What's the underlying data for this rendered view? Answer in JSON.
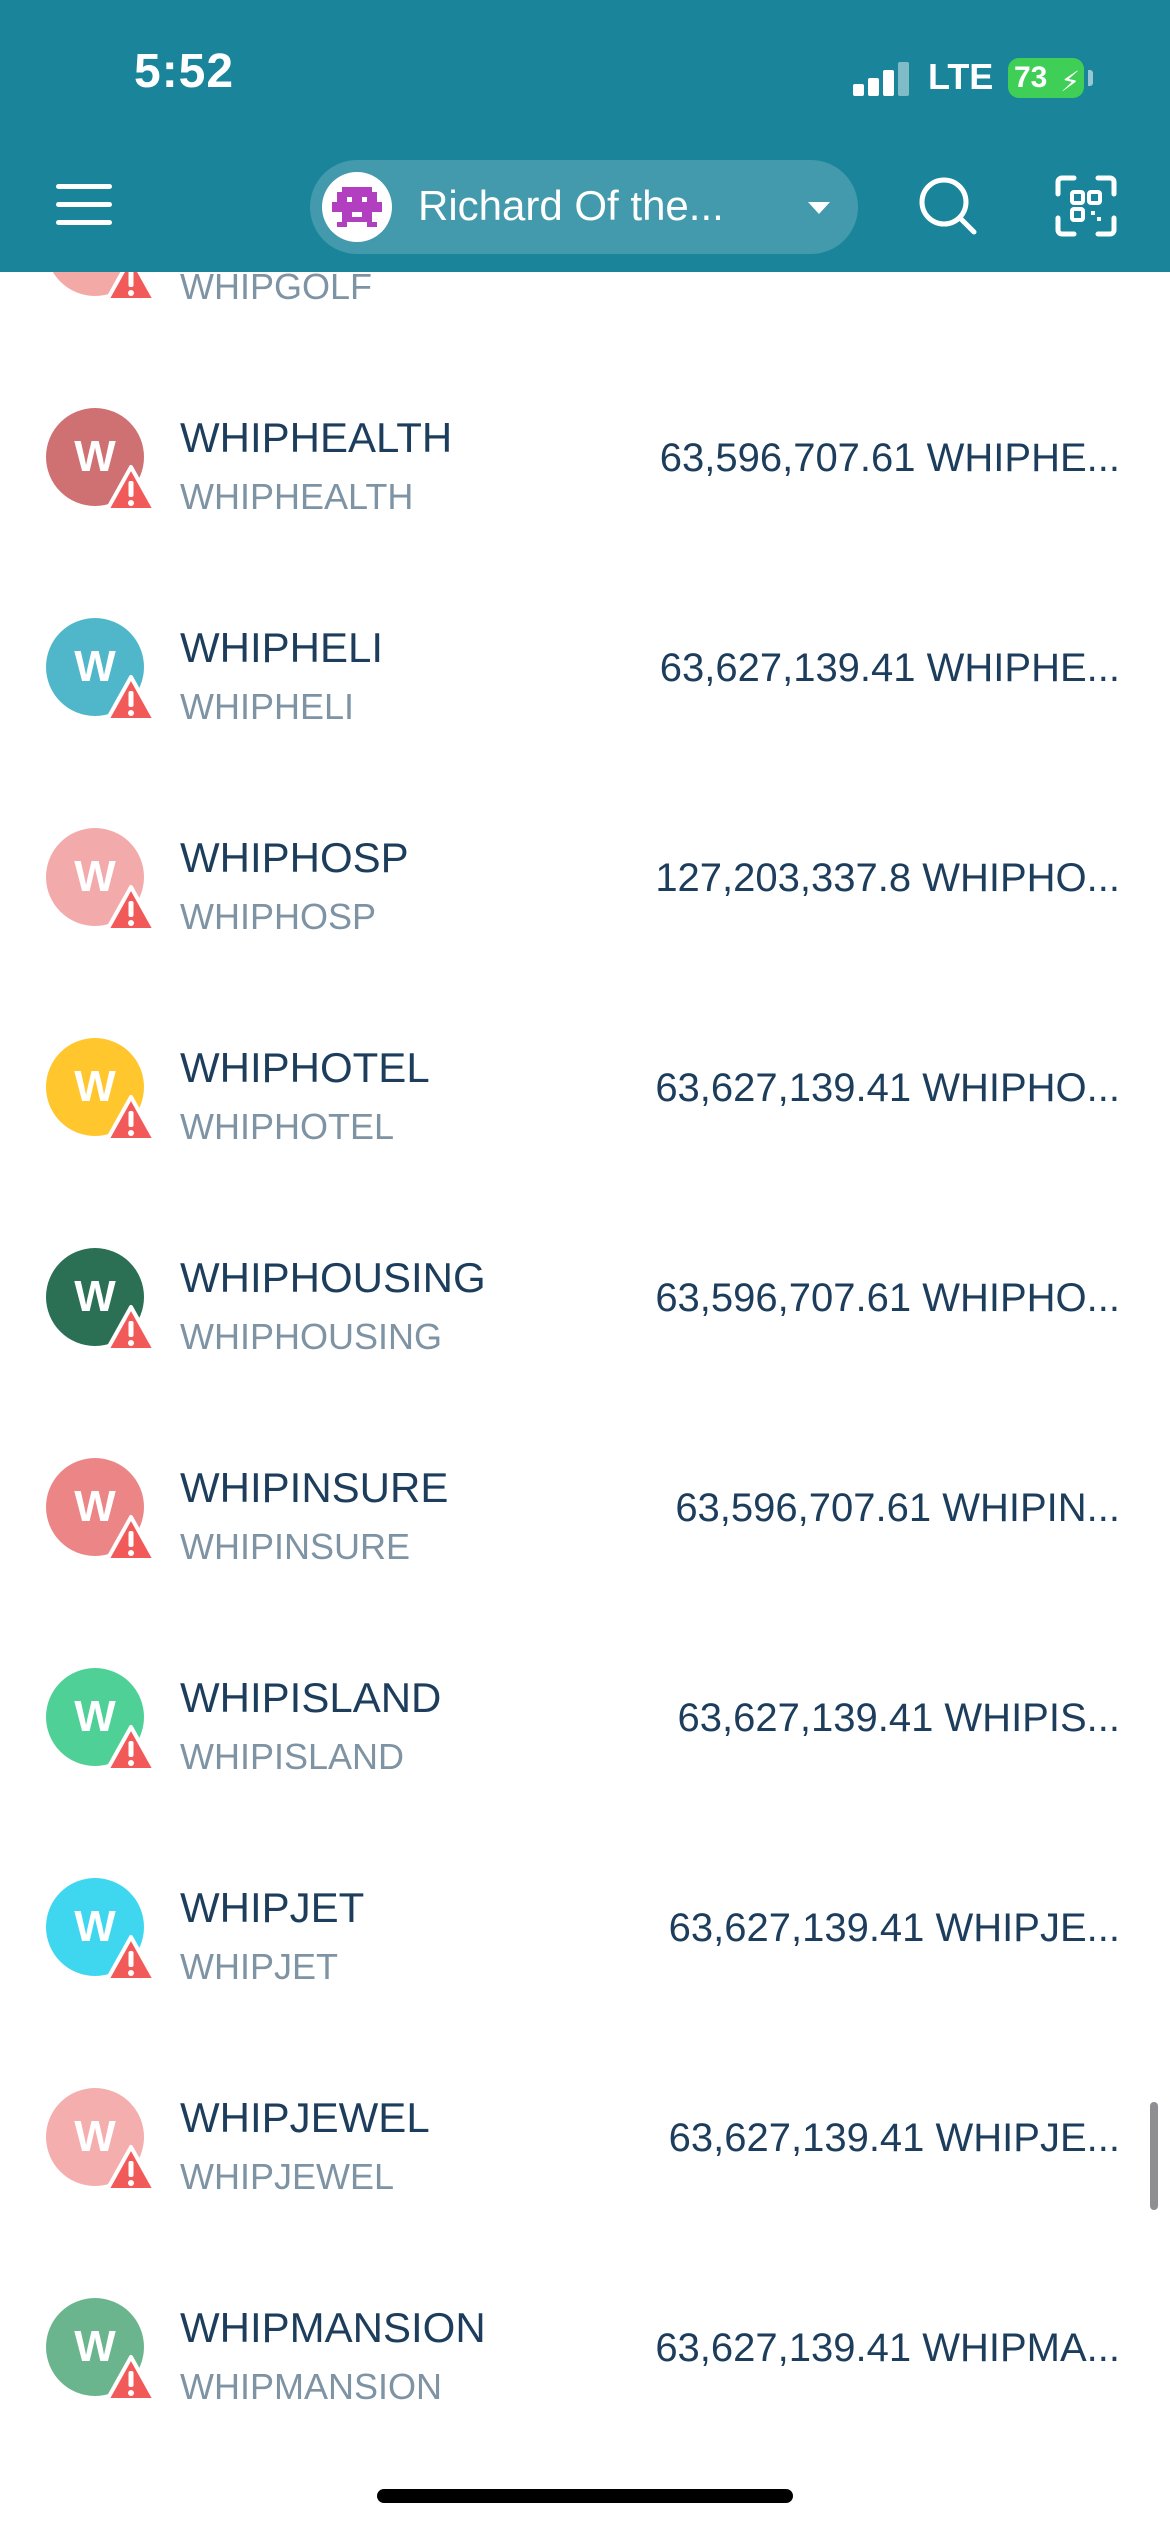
{
  "status_bar": {
    "time": "5:52",
    "network": "LTE",
    "battery": "73"
  },
  "header": {
    "account_name": "Richard Of the...",
    "menu_icon": "hamburger-menu-icon",
    "search_icon": "search-icon",
    "scan_icon": "qr-scan-icon",
    "background_color": "#1a849a"
  },
  "tokens": [
    {
      "symbol": "WHIPGOLF",
      "name": "WHIPGOLF",
      "balance": "",
      "color": "#f3a9a6",
      "letter": "W"
    },
    {
      "symbol": "WHIPHEALTH",
      "name": "WHIPHEALTH",
      "balance": "63,596,707.61 WHIPHE...",
      "color": "#cf7072",
      "letter": "W"
    },
    {
      "symbol": "WHIPHELI",
      "name": "WHIPHELI",
      "balance": "63,627,139.41 WHIPHE...",
      "color": "#4fb7c9",
      "letter": "W"
    },
    {
      "symbol": "WHIPHOSP",
      "name": "WHIPHOSP",
      "balance": "127,203,337.8 WHIPHO...",
      "color": "#f3aaab",
      "letter": "W"
    },
    {
      "symbol": "WHIPHOTEL",
      "name": "WHIPHOTEL",
      "balance": "63,627,139.41 WHIPHO...",
      "color": "#ffc62e",
      "letter": "W"
    },
    {
      "symbol": "WHIPHOUSING",
      "name": "WHIPHOUSING",
      "balance": "63,596,707.61 WHIPHO...",
      "color": "#2b6f55",
      "letter": "W"
    },
    {
      "symbol": "WHIPINSURE",
      "name": "WHIPINSURE",
      "balance": "63,596,707.61 WHIPIN...",
      "color": "#ec8686",
      "letter": "W"
    },
    {
      "symbol": "WHIPISLAND",
      "name": "WHIPISLAND",
      "balance": "63,627,139.41 WHIPIS...",
      "color": "#4fd096",
      "letter": "W"
    },
    {
      "symbol": "WHIPJET",
      "name": "WHIPJET",
      "balance": "63,627,139.41 WHIPJE...",
      "color": "#3ed7ef",
      "letter": "W"
    },
    {
      "symbol": "WHIPJEWEL",
      "name": "WHIPJEWEL",
      "balance": "63,627,139.41 WHIPJE...",
      "color": "#f4aeae",
      "letter": "W"
    },
    {
      "symbol": "WHIPMANSION",
      "name": "WHIPMANSION",
      "balance": "63,627,139.41 WHIPMA...",
      "color": "#6bb58e",
      "letter": "W"
    }
  ]
}
